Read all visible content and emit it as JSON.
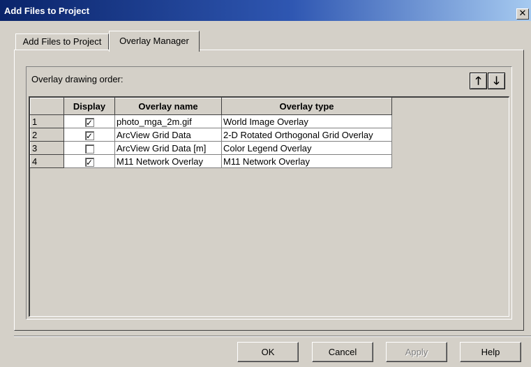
{
  "window": {
    "title": "Add Files to Project",
    "close_glyph": "✕"
  },
  "tabs": [
    {
      "label": "Add Files to Project",
      "active": false
    },
    {
      "label": "Overlay Manager",
      "active": true
    }
  ],
  "overlay": {
    "drawing_order_label": "Overlay drawing order:",
    "up_icon": "🡑",
    "down_icon": "🡓",
    "columns": [
      "",
      "Display",
      "Overlay name",
      "Overlay type"
    ],
    "rows": [
      {
        "num": "1",
        "display": true,
        "name": "photo_mga_2m.gif",
        "type": "World Image Overlay"
      },
      {
        "num": "2",
        "display": true,
        "name": "ArcView Grid Data",
        "type": "2-D Rotated Orthogonal Grid Overlay"
      },
      {
        "num": "3",
        "display": false,
        "name": "ArcView Grid Data [m]",
        "type": "Color Legend Overlay"
      },
      {
        "num": "4",
        "display": true,
        "name": "M11 Network Overlay",
        "type": "M11 Network Overlay"
      }
    ]
  },
  "buttons": {
    "ok": "OK",
    "cancel": "Cancel",
    "apply": "Apply",
    "help": "Help"
  },
  "colors": {
    "titlebar": "#0a246a",
    "face": "#d4d0c8",
    "disabled": "#808080"
  }
}
